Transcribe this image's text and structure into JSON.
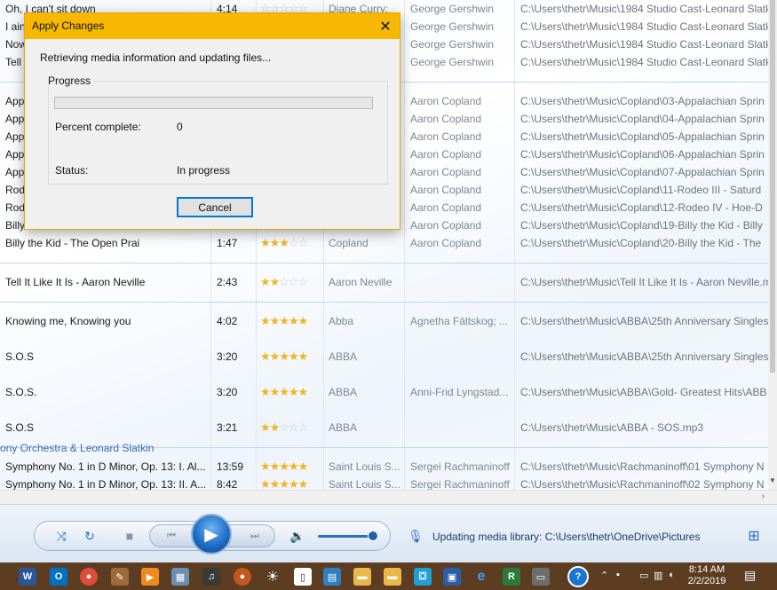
{
  "dialog": {
    "title": "Apply Changes",
    "message": "Retrieving media information and updating files...",
    "group_label": "Progress",
    "progress_fraction": 0,
    "percent_label": "Percent complete:",
    "percent_value": "0",
    "status_label": "Status:",
    "status_value": "In progress",
    "cancel_label": "Cancel"
  },
  "library": {
    "group_header_partial": "ony Orchestra & Leonard Slatkin",
    "rows_top": [
      {
        "title": "Oh, I can't sit down",
        "length": "4:14",
        "rating": 0,
        "artist": "Diane Curry; ",
        "composer": "George Gershwin",
        "path": "C:\\Users\\thetr\\Music\\1984 Studio Cast-Leonard Slatk"
      },
      {
        "title": "I ain",
        "length": "",
        "rating": 0,
        "artist": "",
        "composer": "George Gershwin",
        "path": "C:\\Users\\thetr\\Music\\1984 Studio Cast-Leonard Slatk"
      },
      {
        "title": "Now",
        "length": "",
        "rating": 0,
        "artist": "",
        "composer": "George Gershwin",
        "path": "C:\\Users\\thetr\\Music\\1984 Studio Cast-Leonard Slatk"
      },
      {
        "title": "Tell",
        "length": "",
        "rating": 0,
        "artist": "",
        "composer": "George Gershwin",
        "path": "C:\\Users\\thetr\\Music\\1984 Studio Cast-Leonard Slatk"
      }
    ],
    "rows_copland": [
      {
        "title": "App",
        "length": "",
        "rating": 0,
        "artist": "",
        "composer": "Aaron Copland",
        "path": "C:\\Users\\thetr\\Music\\Copland\\03-Appalachian Sprin"
      },
      {
        "title": "App",
        "length": "",
        "rating": 0,
        "artist": "",
        "composer": "Aaron Copland",
        "path": "C:\\Users\\thetr\\Music\\Copland\\04-Appalachian Sprin"
      },
      {
        "title": "App",
        "length": "",
        "rating": 0,
        "artist": "",
        "composer": "Aaron Copland",
        "path": "C:\\Users\\thetr\\Music\\Copland\\05-Appalachian Sprin"
      },
      {
        "title": "App",
        "length": "",
        "rating": 0,
        "artist": "",
        "composer": "Aaron Copland",
        "path": "C:\\Users\\thetr\\Music\\Copland\\06-Appalachian Sprin"
      },
      {
        "title": "App",
        "length": "",
        "rating": 0,
        "artist": "",
        "composer": "Aaron Copland",
        "path": "C:\\Users\\thetr\\Music\\Copland\\07-Appalachian Sprin"
      },
      {
        "title": "Rod",
        "length": "",
        "rating": 0,
        "artist": "",
        "composer": "Aaron Copland",
        "path": "C:\\Users\\thetr\\Music\\Copland\\11-Rodeo III - Saturd"
      },
      {
        "title": "Rod",
        "length": "",
        "rating": 0,
        "artist": "",
        "composer": "Aaron Copland",
        "path": "C:\\Users\\thetr\\Music\\Copland\\12-Rodeo IV - Hoe-D"
      },
      {
        "title": "Billy",
        "length": "",
        "rating": 0,
        "artist": "",
        "composer": "Aaron Copland",
        "path": "C:\\Users\\thetr\\Music\\Copland\\19-Billy the Kid - Billy"
      },
      {
        "title": "Billy the Kid - The Open Prai",
        "length": "1:47",
        "rating": 3,
        "artist": "Copland",
        "composer": "Aaron Copland",
        "path": "C:\\Users\\thetr\\Music\\Copland\\20-Billy the Kid - The"
      }
    ],
    "row_neville": {
      "title": "Tell It Like It Is - Aaron Neville",
      "length": "2:43",
      "rating": 2,
      "artist": "Aaron Neville",
      "composer": "",
      "path": "C:\\Users\\thetr\\Music\\Tell It Like It Is - Aaron Neville.m"
    },
    "rows_abba": [
      {
        "title": "Knowing me, Knowing you",
        "length": "4:02",
        "rating": 5,
        "artist": "Abba",
        "composer": "Agnetha Fältskog; ...",
        "path": "C:\\Users\\thetr\\Music\\ABBA\\25th Anniversary Singles"
      },
      {
        "title": "S.O.S",
        "length": "3:20",
        "rating": 5,
        "artist": "ABBA",
        "composer": "",
        "path": "C:\\Users\\thetr\\Music\\ABBA\\25th Anniversary Singles"
      },
      {
        "title": "S.O.S.",
        "length": "3:20",
        "rating": 5,
        "artist": "ABBA",
        "composer": "Anni-Frid Lyngstad...",
        "path": "C:\\Users\\thetr\\Music\\ABBA\\Gold- Greatest Hits\\ABB"
      },
      {
        "title": "S.O.S",
        "length": "3:21",
        "rating": 2,
        "artist": "ABBA",
        "composer": "",
        "path": "C:\\Users\\thetr\\Music\\ABBA - SOS.mp3"
      }
    ],
    "rows_rach": [
      {
        "title": "Symphony No. 1 in D Minor, Op. 13: I. Al...",
        "length": "13:59",
        "rating": 5,
        "artist": "Saint Louis S...",
        "composer": "Sergei Rachmaninoff",
        "path": "C:\\Users\\thetr\\Music\\Rachmaninoff\\01 Symphony N"
      },
      {
        "title": "Symphony No. 1 in D Minor, Op. 13: II. A...",
        "length": "8:42",
        "rating": 5,
        "artist": "Saint Louis S...",
        "composer": "Sergei Rachmaninoff",
        "path": "C:\\Users\\thetr\\Music\\Rachmaninoff\\02 Symphony N"
      }
    ]
  },
  "player": {
    "status_text": "Updating media library: C:\\Users\\thetr\\OneDrive\\Pictures",
    "volume_fraction": 0.9,
    "icons": {
      "shuffle": "shuffle-icon",
      "repeat": "repeat-icon",
      "stop": "stop-icon",
      "previous": "previous-icon",
      "play": "play-icon",
      "next": "next-icon",
      "volume": "volume-icon",
      "switch_view": "switch-view-icon"
    }
  },
  "taskbar": {
    "time": "8:14 AM",
    "date": "2/2/2019",
    "accent": "#5c3d22"
  },
  "colors": {
    "dialog_titlebar": "#f6b800",
    "progress_fill": "#06b025",
    "star_on": "#f2b41e",
    "star_off": "#c9cfd6",
    "link_blue": "#3a6bb5"
  }
}
